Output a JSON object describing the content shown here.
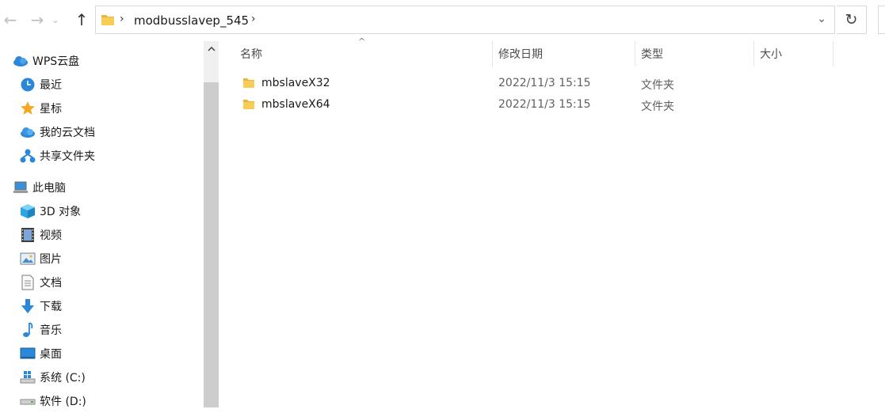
{
  "toolbar": {
    "back_icon": "←",
    "forward_icon": "→",
    "dropdown_icon": "⌄",
    "up_icon": "↑"
  },
  "address_bar": {
    "separator": "›",
    "path": "modbusslavep_545",
    "dropdown_icon": "⌄",
    "refresh_icon": "↻"
  },
  "sidebar": {
    "quick": [
      {
        "label": "WPS云盘",
        "icon": "cloud-icon"
      },
      {
        "label": "最近",
        "icon": "clock-icon"
      },
      {
        "label": "星标",
        "icon": "star-icon"
      },
      {
        "label": "我的云文档",
        "icon": "cloud-doc-icon"
      },
      {
        "label": "共享文件夹",
        "icon": "share-icon"
      }
    ],
    "pc": {
      "label": "此电脑",
      "icon": "computer-icon"
    },
    "pc_items": [
      {
        "label": "3D 对象",
        "icon": "cube-icon"
      },
      {
        "label": "视频",
        "icon": "film-icon"
      },
      {
        "label": "图片",
        "icon": "picture-icon"
      },
      {
        "label": "文档",
        "icon": "document-icon"
      },
      {
        "label": "下载",
        "icon": "download-icon"
      },
      {
        "label": "音乐",
        "icon": "music-icon"
      },
      {
        "label": "桌面",
        "icon": "desktop-icon"
      },
      {
        "label": "系统 (C:)",
        "icon": "windows-drive-icon"
      },
      {
        "label": "软件 (D:)",
        "icon": "drive-icon"
      }
    ]
  },
  "columns": {
    "name": "名称",
    "date": "修改日期",
    "type": "类型",
    "size": "大小",
    "sort_indicator": "^"
  },
  "files": [
    {
      "name": "mbslaveX32",
      "date": "2022/11/3 15:15",
      "type": "文件夹",
      "size": ""
    },
    {
      "name": "mbslaveX64",
      "date": "2022/11/3 15:15",
      "type": "文件夹",
      "size": ""
    }
  ],
  "colors": {
    "folder": "#f5c542",
    "accent": "#2b88d8",
    "scrollbar_thumb": "#cdcdcd"
  }
}
